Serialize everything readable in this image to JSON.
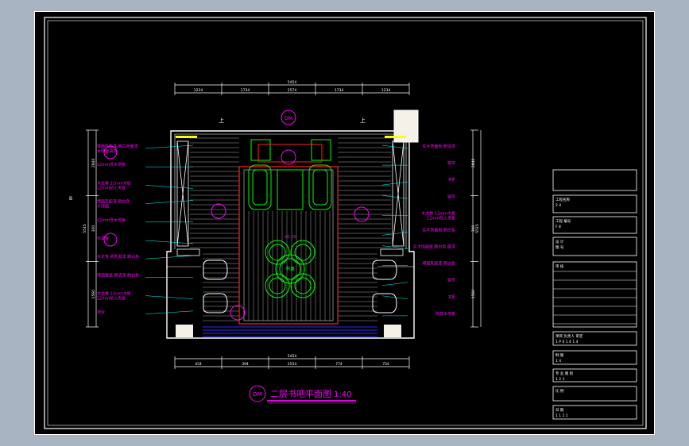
{
  "drawing": {
    "title": "二层书吧平面图",
    "scale": "1:40",
    "view_label": "DM",
    "dim_top_total": "5454",
    "dim_top_segments": [
      "1234",
      "1734",
      "2574",
      "1734",
      "1234"
    ],
    "dim_bottom_total": "5454",
    "dim_bottom_segments": [
      "454",
      "394",
      "2554",
      "774",
      "754"
    ],
    "dim_left_total": "5515",
    "dim_left_segments": [
      "2840",
      "300",
      "1560"
    ],
    "dim_right_total": "5515",
    "dim_right_segments": [
      "2840",
      "300",
      "1560"
    ],
    "up_mark": "上",
    "table_label": "书桌",
    "level_mark": "±0.00",
    "annotations_left": [
      {
        "lines": [
          "墙面乳胶漆 刷白色面漆",
          "木饰面油漆"
        ]
      },
      {
        "lines": [
          "12mm厚木地板"
        ]
      },
      {
        "lines": [
          "木龙骨 12mm木板",
          "12mm防火夹板"
        ]
      },
      {
        "lines": [
          "墙面乳胶漆 刷白色",
          "木饰面"
        ]
      },
      {
        "lines": [
          "12mm厚木地板"
        ]
      },
      {
        "lines": [
          "石膏板"
        ]
      },
      {
        "lines": [
          "木龙骨 刷乳胶漆 刷白色"
        ]
      },
      {
        "lines": [
          "墙面壁纸 刷清漆 刷白色"
        ]
      },
      {
        "lines": [
          "木龙骨 12mm木板",
          "12mm防火夹板"
        ]
      },
      {
        "lines": [
          "地台"
        ]
      }
    ],
    "annotations_right": [
      {
        "lines": [
          "实木饰面板 刷清漆"
        ]
      },
      {
        "lines": [
          "窗帘"
        ]
      },
      {
        "lines": [
          "书柜"
        ]
      },
      {
        "lines": [
          "窗帘"
        ]
      },
      {
        "lines": [
          "木龙骨 12mm木板",
          "12mm防火夹板"
        ]
      },
      {
        "lines": [
          "实木饰面板 刷白色"
        ]
      },
      {
        "lines": [
          "实木饰面板 刷白色 面漆"
        ]
      },
      {
        "lines": [
          "墙面乳胶漆 刷白色"
        ]
      },
      {
        "lines": [
          "窗帘"
        ]
      },
      {
        "lines": [
          "书柜"
        ]
      },
      {
        "lines": [
          "防腐木地板"
        ]
      }
    ],
    "aside_mark": "B"
  },
  "title_block": {
    "rows": [
      {
        "a": "",
        "b": ""
      },
      {
        "a": "工程名称",
        "b": "2 4"
      },
      {
        "a": "工程 编号",
        "b": "F 8"
      },
      {
        "a": "设 计",
        "b": "图 号"
      },
      {
        "a": "审 核",
        "b": ""
      },
      {
        "a": "项目 负责人 审定",
        "b": "1 P 0 1 4 1 4"
      },
      {
        "a": "制 图",
        "b": "1   4"
      },
      {
        "a": "专 业  图 别",
        "b": "1 2 1"
      },
      {
        "a": "比 例",
        "b": ""
      },
      {
        "a": "日 期",
        "b": "1 1 1 1"
      }
    ]
  },
  "colors": {
    "frame": "#ffffff",
    "dimension": "#ffffff",
    "annotation": "#ff00ff",
    "wall": "#ffffff",
    "furniture": "#00ff00",
    "leader": "#00ffff",
    "red": "#ff2020",
    "blue": "#2a2aff",
    "yellow": "#ffff00"
  }
}
